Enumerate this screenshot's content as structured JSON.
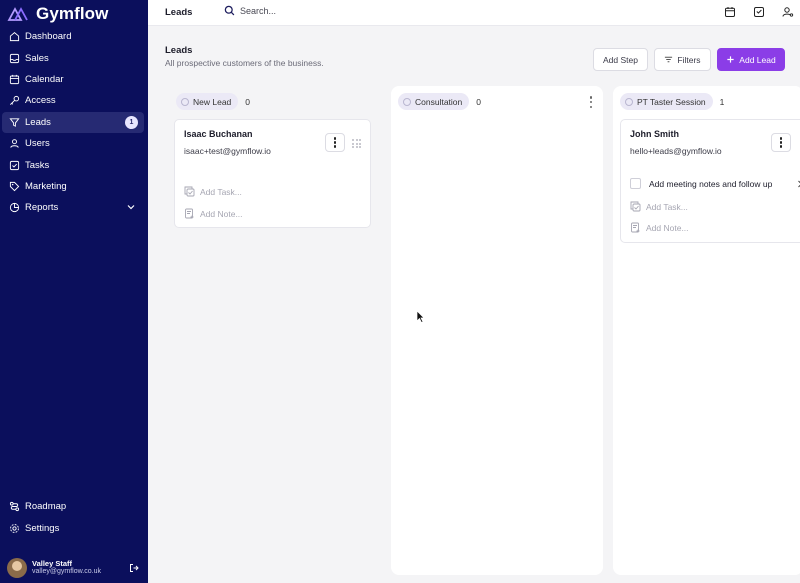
{
  "app": {
    "name": "Gymflow"
  },
  "sidebar": {
    "items": [
      {
        "label": "Dashboard",
        "icon": "home-icon"
      },
      {
        "label": "Sales",
        "icon": "inbox-icon"
      },
      {
        "label": "Calendar",
        "icon": "calendar-icon"
      },
      {
        "label": "Access",
        "icon": "key-icon"
      },
      {
        "label": "Leads",
        "icon": "filter-icon",
        "badge": "1",
        "active": true
      },
      {
        "label": "Users",
        "icon": "users-icon"
      },
      {
        "label": "Tasks",
        "icon": "tasks-icon"
      },
      {
        "label": "Marketing",
        "icon": "tag-icon"
      },
      {
        "label": "Reports",
        "icon": "chart-icon"
      }
    ],
    "bottom_items": [
      {
        "label": "Roadmap",
        "icon": "route-icon"
      },
      {
        "label": "Settings",
        "icon": "gear-icon"
      }
    ],
    "user": {
      "name": "Valley Staff",
      "email": "valley@gymflow.co.uk"
    }
  },
  "topbar": {
    "breadcrumb": "Leads",
    "search_placeholder": "Search..."
  },
  "header": {
    "title": "Leads",
    "subtitle": "All prospective customers of the business.",
    "add_step_label": "Add Step",
    "filters_label": "Filters",
    "add_lead_label": "Add Lead"
  },
  "columns": [
    {
      "name": "New Lead",
      "count": "0"
    },
    {
      "name": "Consultation",
      "count": "0"
    },
    {
      "name": "PT Taster Session",
      "count": "1"
    }
  ],
  "cards": [
    {
      "name": "Isaac Buchanan",
      "email": "isaac+test@gymflow.io",
      "add_task": "Add Task...",
      "add_note": "Add Note..."
    },
    {
      "name": "John Smith",
      "email": "hello+leads@gymflow.io",
      "task": "Add meeting notes and follow up",
      "add_task": "Add Task...",
      "add_note": "Add Note..."
    }
  ],
  "colors": {
    "sidebar_bg": "#0b0f5c",
    "accent": "#8b3de7"
  }
}
